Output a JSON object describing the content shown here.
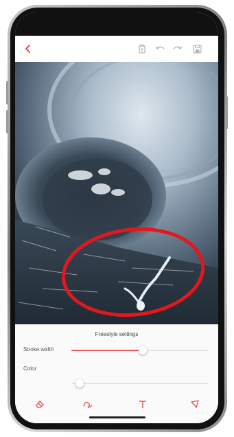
{
  "toolbar": {
    "icons": [
      "back-arrow-icon",
      "trash-icon",
      "undo-icon",
      "redo-icon",
      "save-icon"
    ],
    "accent": "#e84b4b"
  },
  "photo": {
    "annotation_color": "#e3171d"
  },
  "settings": {
    "title": "Freestyle settings",
    "stroke_width_label": "Stroke width",
    "stroke_width_value": 0.52,
    "color_label": "Color",
    "color_value": 0.03
  },
  "tools": [
    "eraser-icon",
    "freestyle-pen-icon",
    "text-tool-icon",
    "shape-tool-icon"
  ]
}
